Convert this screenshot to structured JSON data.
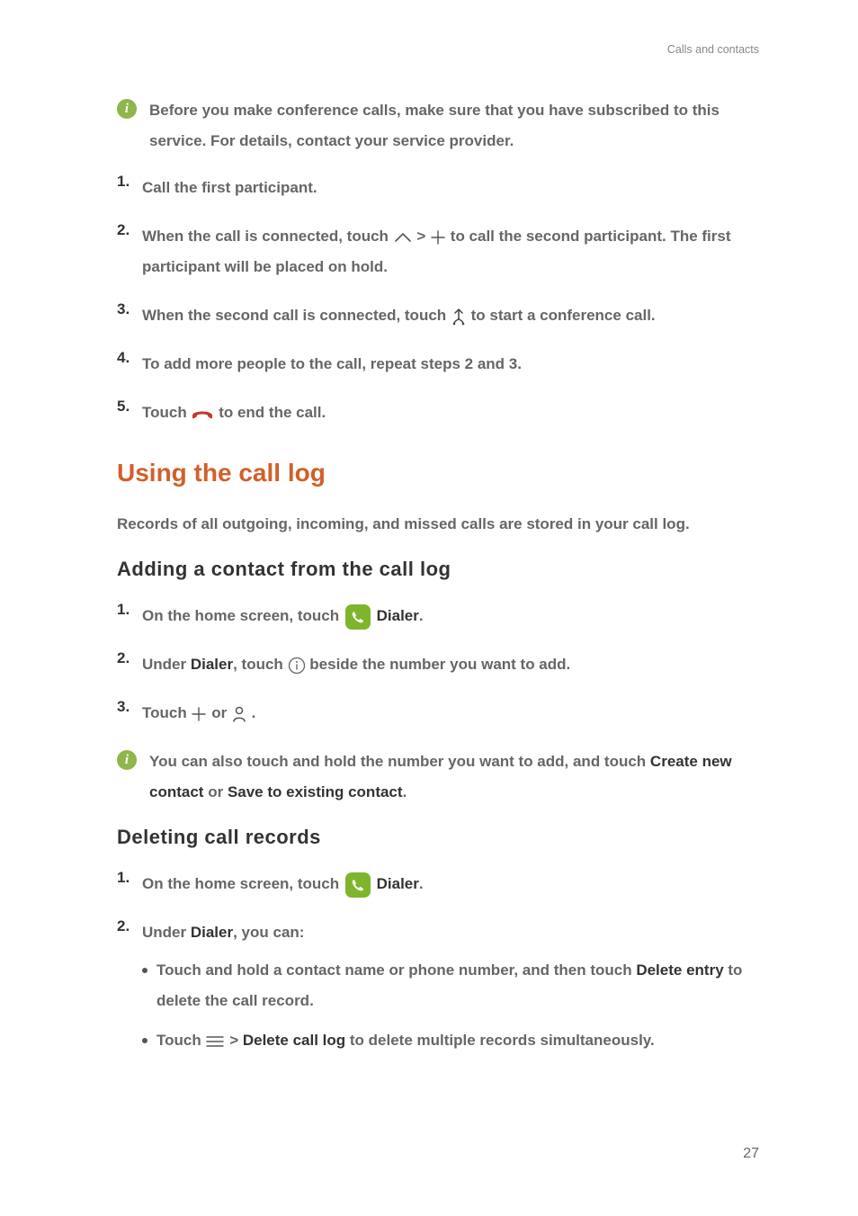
{
  "header": {
    "section": "Calls and contacts"
  },
  "note1": "Before you make conference calls, make sure that you have subscribed to this service. For details, contact your service provider.",
  "steps_a": {
    "s1": "Call the first participant.",
    "s2_a": "When the call is connected, touch ",
    "s2_b": " > ",
    "s2_c": " to call the second participant. The first participant will be placed on hold.",
    "s3_a": "When the second call is connected, touch ",
    "s3_b": " to start a conference call.",
    "s4": "To add more people to the call, repeat steps 2 and 3.",
    "s5_a": "Touch ",
    "s5_b": " to end the call."
  },
  "h1": "Using the call log",
  "intro": "Records of all outgoing, incoming, and missed calls are stored in your call log.",
  "h2a": "Adding a contact from the call log",
  "add": {
    "s1_a": "On the home screen, touch ",
    "s1_label": "Dialer",
    "s1_b": ".",
    "s2_a": "Under ",
    "s2_dialer": "Dialer",
    "s2_b": ", touch ",
    "s2_c": " beside the number you want to add.",
    "s3_a": "Touch ",
    "s3_b": " or ",
    "s3_c": " ."
  },
  "note2_a": "You can also touch and hold the number you want to add, and touch ",
  "note2_b1": "Create new contact",
  "note2_or": " or ",
  "note2_b2": "Save to existing contact",
  "note2_c": ".",
  "h2b": "Deleting call records",
  "del": {
    "s1_a": "On the home screen, touch ",
    "s1_label": "Dialer",
    "s1_b": ".",
    "s2_a": "Under ",
    "s2_dialer": "Dialer",
    "s2_b": ", you can:",
    "b1_a": "Touch and hold a contact name or phone number, and then touch ",
    "b1_bold": "Delete entry",
    "b1_b": " to delete the call record.",
    "b2_a": "Touch ",
    "b2_b": " > ",
    "b2_bold": "Delete call log",
    "b2_c": " to delete multiple records simultaneously."
  },
  "page": "27",
  "nums": {
    "n1": "1.",
    "n2": "2.",
    "n3": "3.",
    "n4": "4.",
    "n5": "5."
  }
}
